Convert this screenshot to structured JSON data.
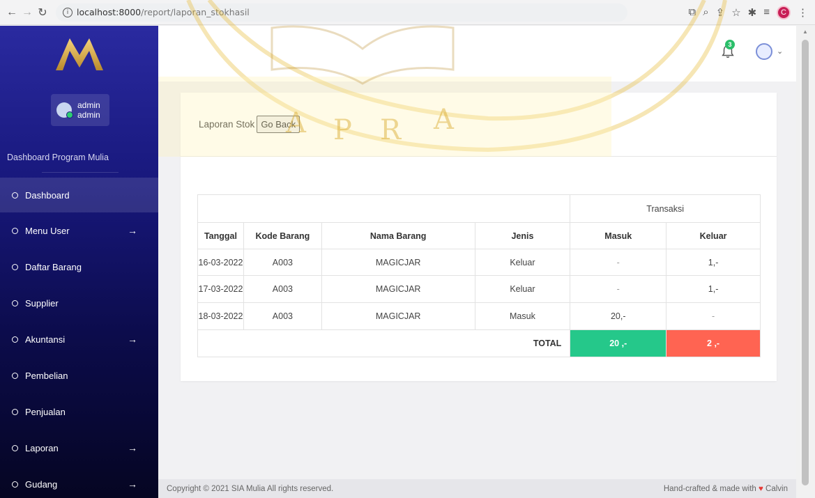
{
  "browser": {
    "url_host": "localhost:8000",
    "url_path": "/report/laporan_stokhasil",
    "profile_initial": "C"
  },
  "sidebar": {
    "user": {
      "name": "admin",
      "role": "admin"
    },
    "section_title": "Dashboard Program Mulia",
    "items": [
      {
        "label": "Dashboard",
        "has_arrow": false
      },
      {
        "label": "Menu User",
        "has_arrow": true
      },
      {
        "label": "Daftar Barang",
        "has_arrow": false
      },
      {
        "label": "Supplier",
        "has_arrow": false
      },
      {
        "label": "Akuntansi",
        "has_arrow": true
      },
      {
        "label": "Pembelian",
        "has_arrow": false
      },
      {
        "label": "Penjualan",
        "has_arrow": false
      },
      {
        "label": "Laporan",
        "has_arrow": true
      },
      {
        "label": "Gudang",
        "has_arrow": true
      }
    ],
    "arrow_glyph": "→"
  },
  "header": {
    "notification_count": "3"
  },
  "card": {
    "title": "Laporan Stok",
    "go_back_label": "Go Back"
  },
  "table": {
    "group_header": "Transaksi",
    "columns": [
      "Tanggal",
      "Kode Barang",
      "Nama Barang",
      "Jenis",
      "Masuk",
      "Keluar"
    ],
    "rows": [
      [
        "16-03-2022",
        "A003",
        "MAGICJAR",
        "Keluar",
        "-",
        "1,-"
      ],
      [
        "17-03-2022",
        "A003",
        "MAGICJAR",
        "Keluar",
        "-",
        "1,-"
      ],
      [
        "18-03-2022",
        "A003",
        "MAGICJAR",
        "Masuk",
        "20,-",
        "-"
      ]
    ],
    "total_label": "TOTAL",
    "total_masuk": "20 ,-",
    "total_keluar": "2 ,-"
  },
  "footer": {
    "copyright": "Copyright © 2021 SIA Mulia All rights reserved.",
    "credit_prefix": "Hand-crafted & made with",
    "credit_name": "Calvin"
  },
  "colors": {
    "sidebar_top": "#2a2aa0",
    "sidebar_bottom": "#050522",
    "total_in": "#25c88a",
    "total_out": "#ff6452",
    "watermark": "#f2cf55"
  }
}
